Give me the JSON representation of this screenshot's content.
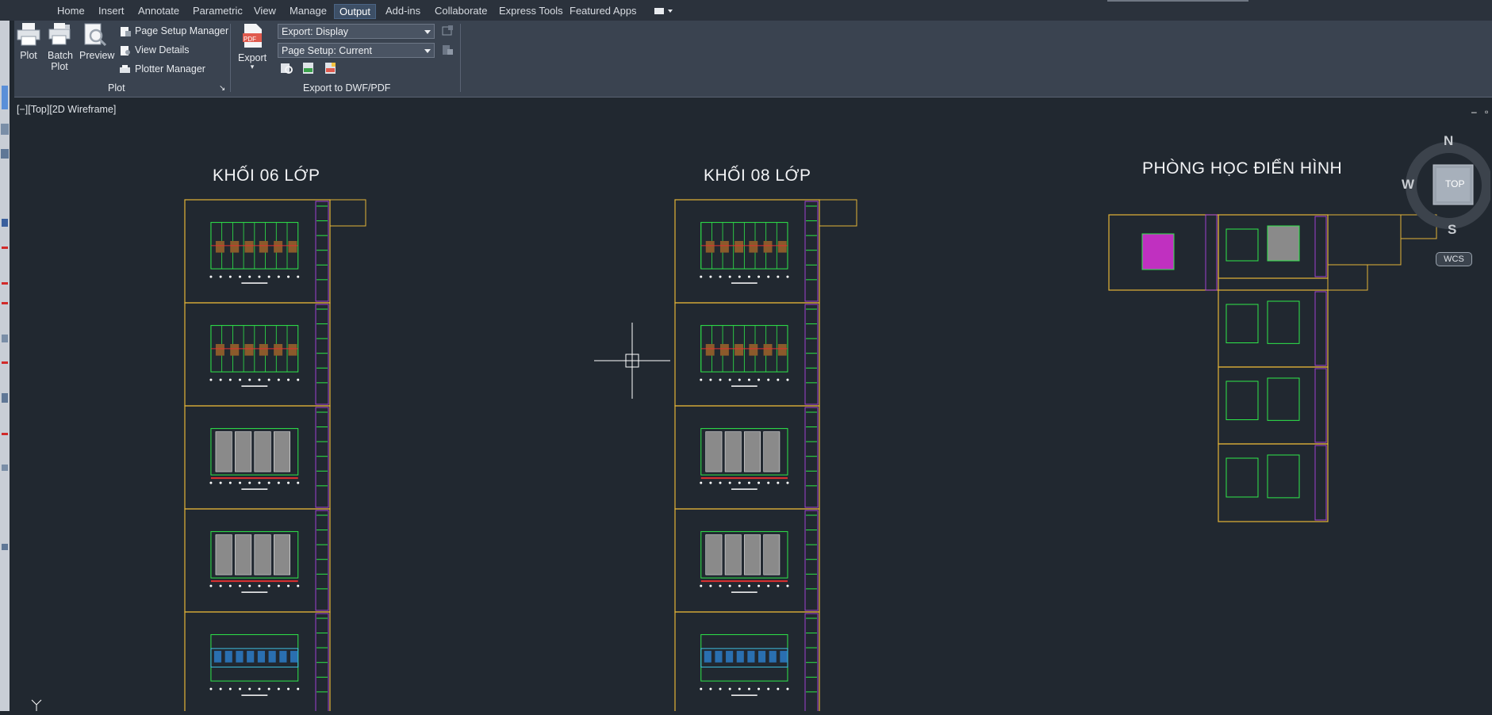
{
  "app": {
    "icon": "autocad-logo-icon"
  },
  "tabs": [
    {
      "label": "Home",
      "active": false
    },
    {
      "label": "Insert",
      "active": false
    },
    {
      "label": "Annotate",
      "active": false
    },
    {
      "label": "Parametric",
      "active": false
    },
    {
      "label": "View",
      "active": false
    },
    {
      "label": "Manage",
      "active": false
    },
    {
      "label": "Output",
      "active": true
    },
    {
      "label": "Add-ins",
      "active": false
    },
    {
      "label": "Collaborate",
      "active": false
    },
    {
      "label": "Express Tools",
      "active": false
    },
    {
      "label": "Featured Apps",
      "active": false
    }
  ],
  "ribbon": {
    "plot_panel": {
      "plot": "Plot",
      "batch_plot_line1": "Batch",
      "batch_plot_line2": "Plot",
      "preview": "Preview",
      "page_setup_manager": "Page Setup Manager",
      "view_details": "View Details",
      "plotter_manager": "Plotter Manager",
      "panel_title": "Plot"
    },
    "export_panel": {
      "export": "Export",
      "pdf_badge": "PDF",
      "export_display": "Export: Display",
      "page_setup": "Page Setup: Current",
      "panel_title": "Export to DWF/PDF"
    }
  },
  "viewport": {
    "label": "[−][Top][2D Wireframe]"
  },
  "drawing": {
    "titles": [
      "KHỐI 06 LỚP",
      "KHỐI 08 LỚP",
      "PHÒNG HỌC ĐIỂN HÌNH"
    ]
  },
  "viewcube": {
    "north": "N",
    "south": "S",
    "west": "W",
    "face": "TOP",
    "wcs": "WCS"
  },
  "colors": {
    "background": "#212830",
    "sheet_border": "#e3b338",
    "linework": "#2ee84a",
    "ribbon": "#3a4350"
  }
}
